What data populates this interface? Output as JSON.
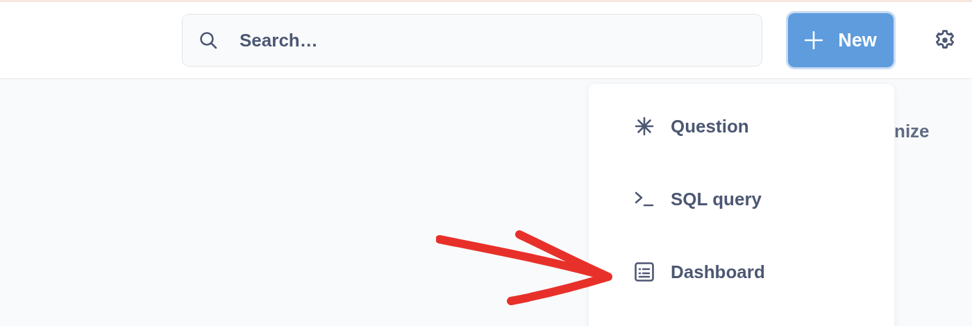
{
  "search": {
    "placeholder": "Search…"
  },
  "new_button": {
    "label": "New"
  },
  "background_text": "nize",
  "menu": {
    "items": [
      {
        "kind": "question",
        "label": "Question"
      },
      {
        "kind": "sql",
        "label": "SQL query"
      },
      {
        "kind": "dashboard",
        "label": "Dashboard"
      }
    ]
  }
}
